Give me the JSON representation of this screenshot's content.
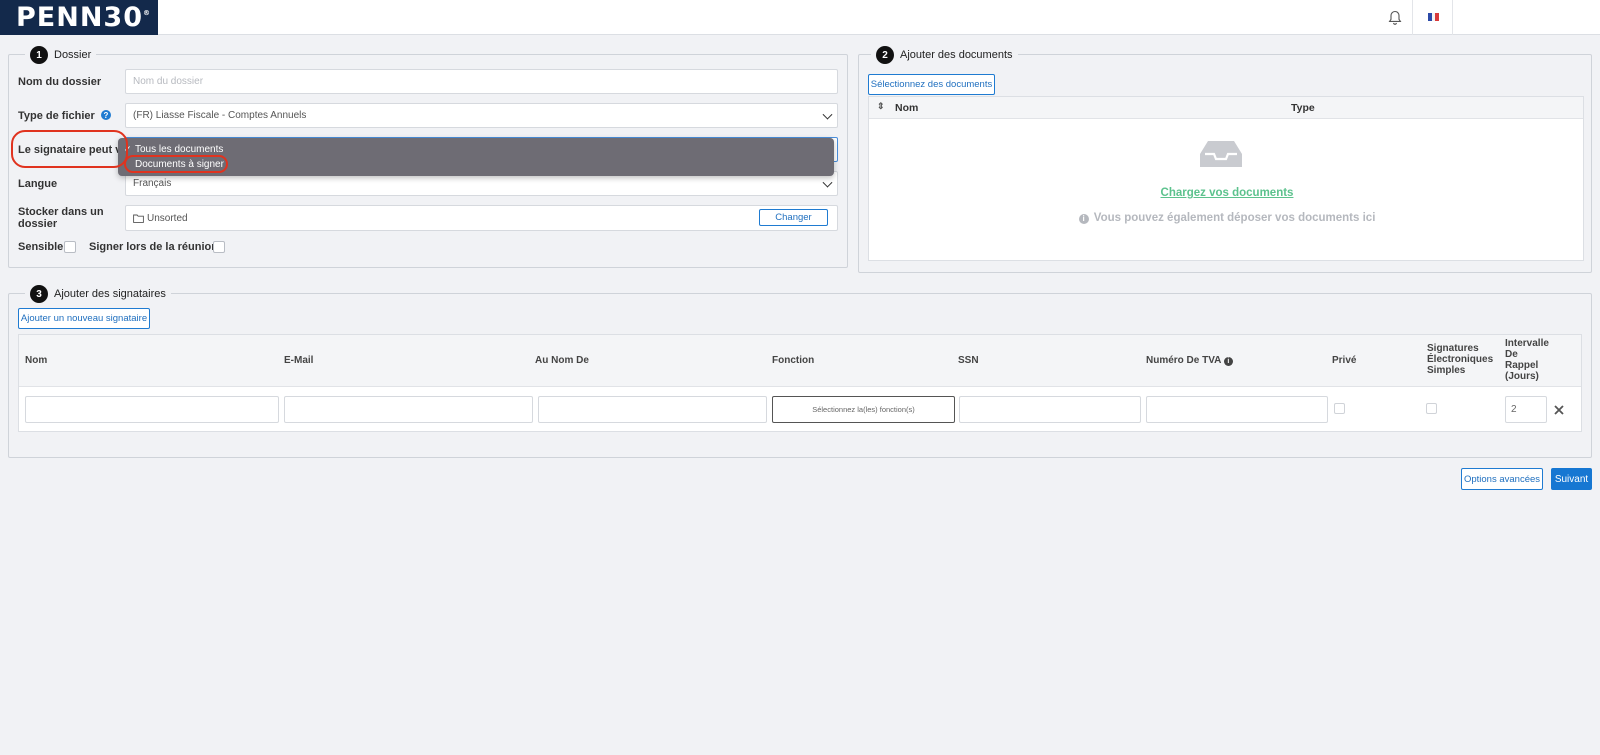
{
  "header": {
    "logo": "PENN30",
    "logo_mark": "®",
    "icons": [
      "bell-icon",
      "flag-fr-icon"
    ]
  },
  "dossier": {
    "step": "1",
    "title": "Dossier",
    "name_label": "Nom du dossier",
    "name_placeholder": "Nom du dossier",
    "type_label": "Type de fichier",
    "type_value": "(FR) Liasse Fiscale - Comptes Annuels",
    "signer_label": "Le signataire peut vo",
    "language_label": "Langue",
    "language_value": "Français",
    "store_label": "Stocker dans un dossier",
    "store_value": "Unsorted",
    "change_button": "Changer",
    "sensitive_label": "Sensible",
    "meeting_label": "Signer lors de la réunion"
  },
  "dropdown": {
    "options": [
      "Tous les documents",
      "Documents à signer"
    ],
    "selected_index": 1
  },
  "documents": {
    "step": "2",
    "title": "Ajouter des documents",
    "select_button": "Sélectionnez des documents",
    "col_name": "Nom",
    "col_type": "Type",
    "upload_link": "Chargez vos documents",
    "drop_hint": "Vous pouvez également déposer vos documents ici"
  },
  "signers": {
    "step": "3",
    "title": "Ajouter des signataires",
    "add_button": "Ajouter un nouveau signataire",
    "columns": {
      "nom": "Nom",
      "email": "E-Mail",
      "au_nom_de": "Au Nom De",
      "fonction": "Fonction",
      "ssn": "SSN",
      "tva": "Numéro De TVA",
      "prive": "Privé",
      "signatures_1": "Signatures",
      "signatures_2": "Électroniques",
      "signatures_3": "Simples",
      "intervalle_1": "Intervalle",
      "intervalle_2": "De",
      "intervalle_3": "Rappel",
      "intervalle_4": "(Jours)"
    },
    "function_select": "Sélectionnez la(les) fonction(s)",
    "reminder_value": "2"
  },
  "footer": {
    "advanced_button": "Options avancées",
    "next_button": "Suivant"
  },
  "colors": {
    "brand_navy": "#13294b",
    "primary_blue": "#1677d2",
    "upload_green": "#5cc28d",
    "annotation_red": "#e0331f"
  }
}
